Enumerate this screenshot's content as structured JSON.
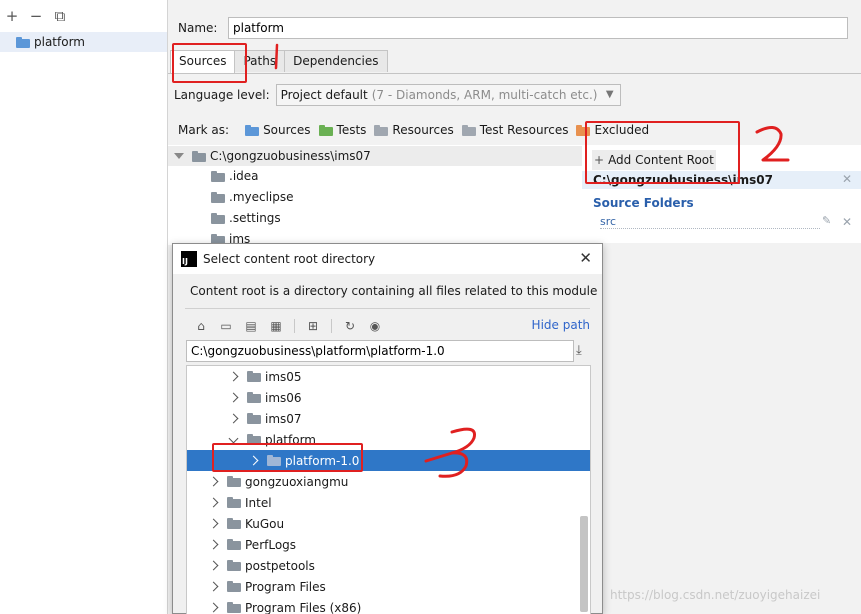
{
  "left": {
    "toolbar": [
      "+",
      "−",
      "⧉"
    ],
    "module": "platform"
  },
  "name": {
    "label": "Name:",
    "value": "platform"
  },
  "tabs": [
    {
      "label": "Sources"
    },
    {
      "label": "Paths"
    },
    {
      "label": "Dependencies"
    }
  ],
  "language": {
    "label": "Language level:",
    "value": "Project default",
    "hint": "(7 - Diamonds, ARM, multi-catch etc.)"
  },
  "mark_as": {
    "label": "Mark as:",
    "items": [
      "Sources",
      "Tests",
      "Resources",
      "Test Resources",
      "Excluded"
    ]
  },
  "content_tree": {
    "root": "C:\\gongzuobusiness\\ims07",
    "children": [
      ".idea",
      ".myeclipse",
      ".settings",
      "ims"
    ]
  },
  "content_panel": {
    "add_root": "Add Content Root",
    "root_path": "C:\\gongzuobusiness\\ims07",
    "source_folders_title": "Source Folders",
    "source_item": "src"
  },
  "dialog": {
    "title": "Select content root directory",
    "description": "Content root is a directory containing all files related to this module",
    "hide_path": "Hide path",
    "path": "C:\\gongzuobusiness\\platform\\platform-1.0",
    "rows": [
      {
        "name": "ims05",
        "state": "collapsed"
      },
      {
        "name": "ims06",
        "state": "collapsed"
      },
      {
        "name": "ims07",
        "state": "collapsed"
      },
      {
        "name": "platform",
        "state": "expanded"
      },
      {
        "name": "platform-1.0",
        "state": "collapsed",
        "selected": true
      },
      {
        "name": "gongzuoxiangmu",
        "state": "collapsed"
      },
      {
        "name": "Intel",
        "state": "collapsed"
      },
      {
        "name": "KuGou",
        "state": "collapsed"
      },
      {
        "name": "PerfLogs",
        "state": "collapsed"
      },
      {
        "name": "postpetools",
        "state": "collapsed"
      },
      {
        "name": "Program Files",
        "state": "collapsed"
      },
      {
        "name": "Program Files (x86)",
        "state": "collapsed"
      }
    ]
  },
  "annotations": [
    "1",
    "2",
    "3"
  ],
  "watermark": "https://blog.csdn.net/zuoyigehaizei",
  "colors": {
    "selection": "#2f77c7",
    "annotation": "#e02020",
    "link": "#2f65ca"
  }
}
